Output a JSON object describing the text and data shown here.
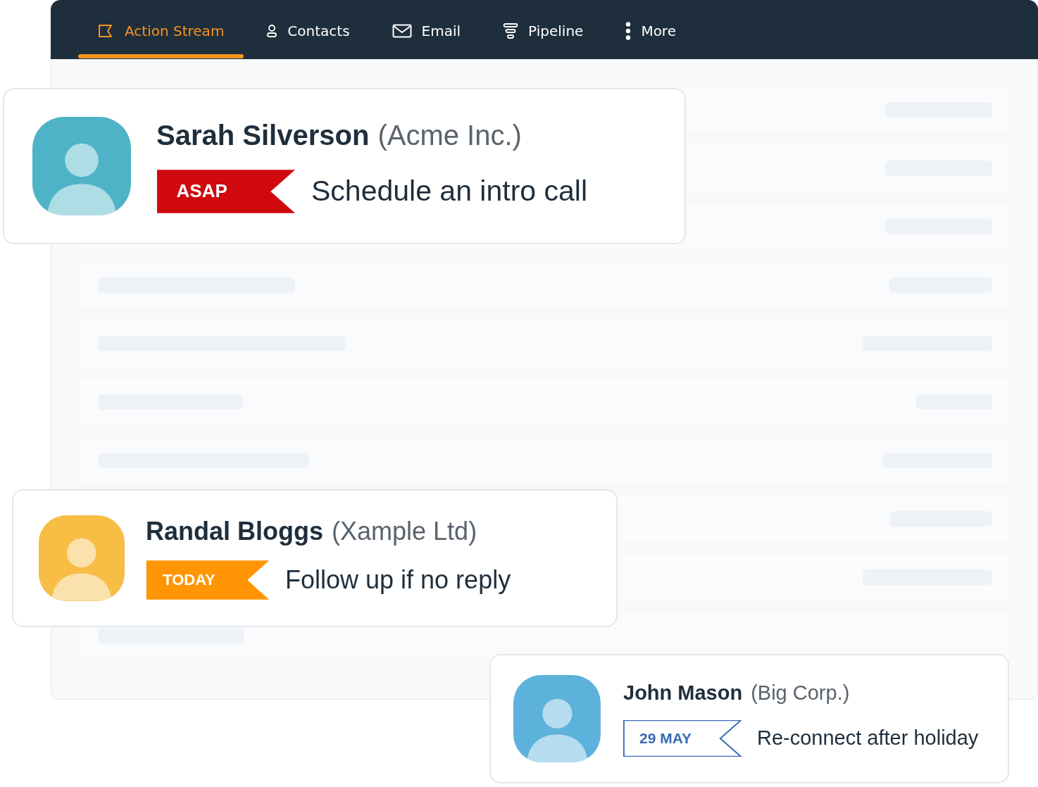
{
  "nav": {
    "items": [
      {
        "label": "Action Stream",
        "selected": true
      },
      {
        "label": "Contacts",
        "selected": false
      },
      {
        "label": "Email",
        "selected": false
      },
      {
        "label": "Pipeline",
        "selected": false
      },
      {
        "label": "More",
        "selected": false
      }
    ]
  },
  "cards": [
    {
      "name": "Sarah Silverson",
      "company": "(Acme Inc.)",
      "tag": {
        "label": "ASAP",
        "kind": "urgent"
      },
      "task": "Schedule an intro call"
    },
    {
      "name": "Randal Bloggs",
      "company": "(Xample Ltd)",
      "tag": {
        "label": "TODAY",
        "kind": "today"
      },
      "task": "Follow up if no reply"
    },
    {
      "name": "John Mason",
      "company": "(Big Corp.)",
      "tag": {
        "label": "29 MAY",
        "kind": "date"
      },
      "task": "Re-connect after holiday"
    }
  ]
}
